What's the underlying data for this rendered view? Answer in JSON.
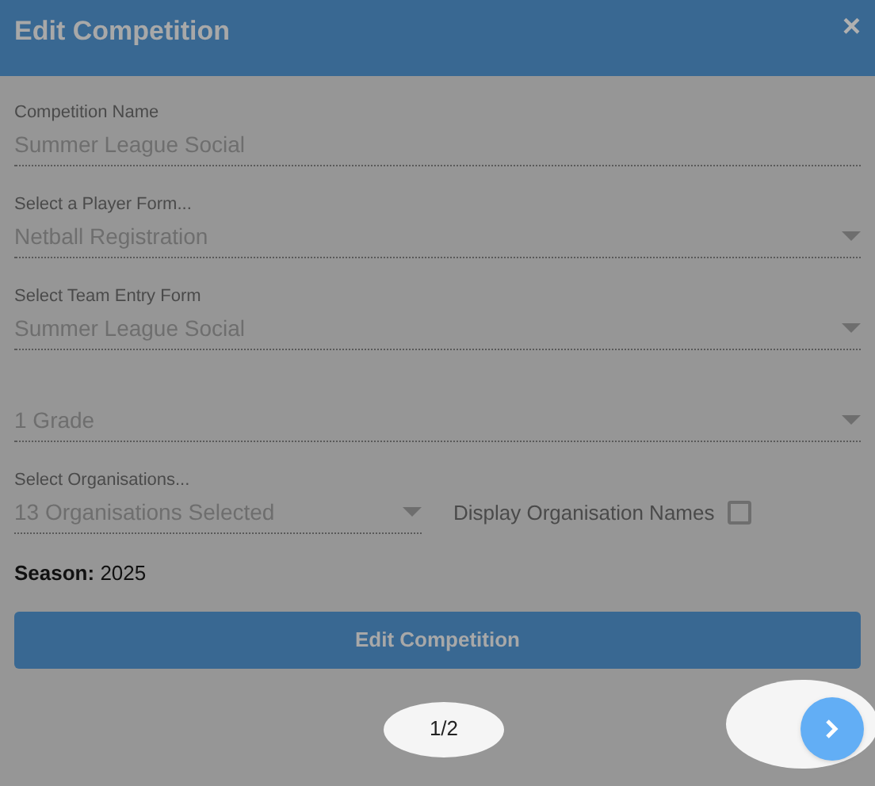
{
  "dialog": {
    "title": "Edit Competition",
    "close": "×"
  },
  "fields": [
    {
      "kind": "text",
      "label": "Competition Name",
      "value": "Summer League Social"
    },
    {
      "kind": "select",
      "label": "Select a Player Form...",
      "value": "Netball Registration"
    },
    {
      "kind": "select",
      "label": "Select Team Entry Form",
      "value": "Summer League Social"
    },
    {
      "kind": "select",
      "value": "1 Grade"
    }
  ],
  "organisations": {
    "label": "Select Organisations...",
    "value": "13 Organisations Selected",
    "checkbox_label": "Display Organisation Names",
    "checked": false
  },
  "season": "**Season:** 2025",
  "submit": "Edit Competition",
  "pager": {
    "page": "1/2"
  }
}
